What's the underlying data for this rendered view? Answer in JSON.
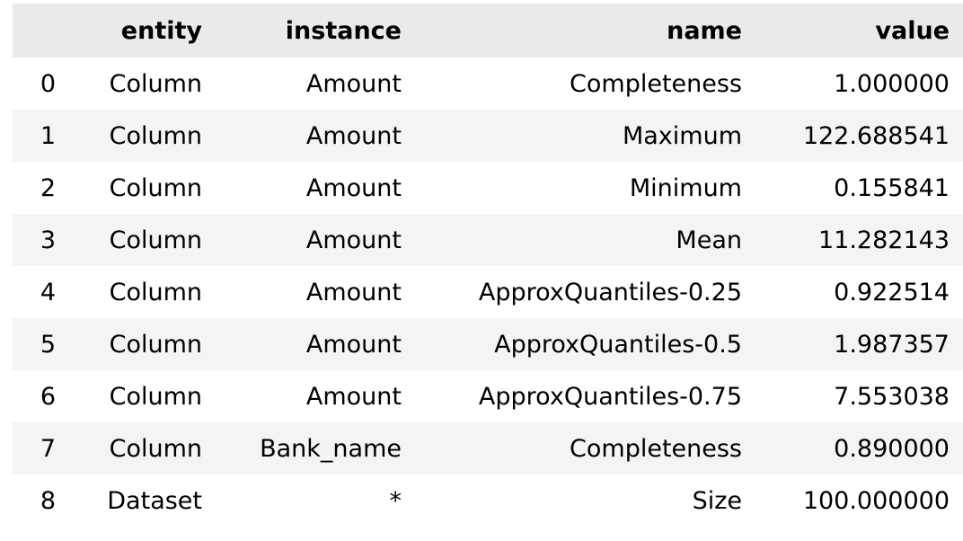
{
  "table": {
    "index_header": "",
    "columns": [
      "entity",
      "instance",
      "name",
      "value"
    ],
    "rows": [
      {
        "index": "0",
        "entity": "Column",
        "instance": "Amount",
        "name": "Completeness",
        "value": "1.000000"
      },
      {
        "index": "1",
        "entity": "Column",
        "instance": "Amount",
        "name": "Maximum",
        "value": "122.688541"
      },
      {
        "index": "2",
        "entity": "Column",
        "instance": "Amount",
        "name": "Minimum",
        "value": "0.155841"
      },
      {
        "index": "3",
        "entity": "Column",
        "instance": "Amount",
        "name": "Mean",
        "value": "11.282143"
      },
      {
        "index": "4",
        "entity": "Column",
        "instance": "Amount",
        "name": "ApproxQuantiles-0.25",
        "value": "0.922514"
      },
      {
        "index": "5",
        "entity": "Column",
        "instance": "Amount",
        "name": "ApproxQuantiles-0.5",
        "value": "1.987357"
      },
      {
        "index": "6",
        "entity": "Column",
        "instance": "Amount",
        "name": "ApproxQuantiles-0.75",
        "value": "7.553038"
      },
      {
        "index": "7",
        "entity": "Column",
        "instance": "Bank_name",
        "name": "Completeness",
        "value": "0.890000"
      },
      {
        "index": "8",
        "entity": "Dataset",
        "instance": "*",
        "name": "Size",
        "value": "100.000000"
      }
    ],
    "colors": {
      "header_background": "#eaeaea",
      "stripe_background": "#f4f4f4",
      "row_background": "#ffffff",
      "text": "#000000"
    }
  }
}
